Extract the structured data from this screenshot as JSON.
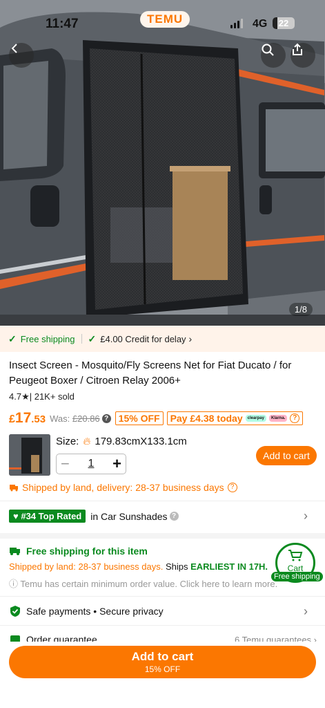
{
  "status": {
    "time": "11:47",
    "brand": "TEMU",
    "network": "4G",
    "battery": "22"
  },
  "gallery": {
    "counter": "1/8"
  },
  "banner": {
    "free_shipping": "Free shipping",
    "credit": "£4.00 Credit for delay",
    "credit_chevron": "›"
  },
  "product": {
    "title": "Insect Screen - Mosquito/Fly Screens Net for Fiat Ducato / for Peugeot Boxer / Citroen Relay 2006+",
    "rating": "4.7",
    "sold": "| 21K+ sold",
    "price_currency": "£",
    "price_whole": "17",
    "price_decimals": ".53",
    "was_label": "Was:",
    "was_price": "£20.86",
    "discount": "15% OFF",
    "pay_today": "Pay £4.38 today",
    "bnpl_1": "clearpay",
    "bnpl_2": "Klarna."
  },
  "options": {
    "size_label": "Size:",
    "size_value": "179.83cmX133.1cm",
    "qty_minus": "−",
    "qty": "1",
    "qty_plus": "+",
    "add_to_cart": "Add to cart"
  },
  "delivery": {
    "text": "Shipped by land, delivery: 28-37 business days"
  },
  "ranking": {
    "badge": "#34 Top Rated",
    "category": "in Car Sunshades"
  },
  "shipping": {
    "title": "Free shipping for this item",
    "sub_orange": "Shipped by land: 28-37 business days.",
    "sub_black": " Ships ",
    "sub_green": "EARLIEST IN 17H.",
    "note": "ⓘ Temu has certain minimum order value. Click here to learn more."
  },
  "cart_float": {
    "label": "Cart",
    "tag": "Free shipping"
  },
  "safety": {
    "text": "Safe payments • Secure privacy"
  },
  "order": {
    "text": "Order guarantee",
    "right": "6 Temu guarantees ›"
  },
  "bottom": {
    "add_to_cart": "Add to cart",
    "discount": "15% OFF"
  },
  "colors": {
    "accent": "#fb7701",
    "green": "#0a8a1f"
  },
  "icons": [
    "back-icon",
    "search-icon",
    "share-icon",
    "check-icon",
    "flame-icon",
    "truck-icon",
    "shield-icon",
    "cart-icon",
    "chevron-right-icon"
  ]
}
